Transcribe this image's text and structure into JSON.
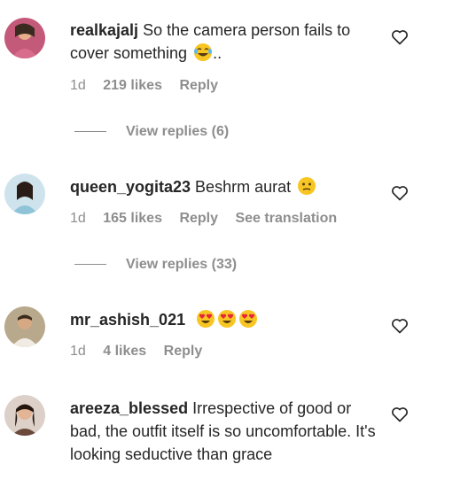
{
  "comments": [
    {
      "username": "realkajalj",
      "text": "So the camera person fails to cover something",
      "suffix": "..",
      "time": "1d",
      "likes": "219 likes",
      "reply": "Reply",
      "view_replies": "View replies (6)",
      "emoji": [
        "laughing-tears-emoji"
      ]
    },
    {
      "username": "queen_yogita23",
      "text": "Beshrm aurat",
      "time": "1d",
      "likes": "165 likes",
      "reply": "Reply",
      "see_translation": "See translation",
      "view_replies": "View replies (33)",
      "emoji": [
        "neutral-face-emoji"
      ]
    },
    {
      "username": "mr_ashish_021",
      "text": "",
      "time": "1d",
      "likes": "4 likes",
      "reply": "Reply",
      "emoji": [
        "heart-eyes-emoji",
        "heart-eyes-emoji",
        "heart-eyes-emoji"
      ]
    },
    {
      "username": "areeza_blessed",
      "text": "Irrespective of good or bad, the outfit itself is so uncomfortable. It's looking seductive than grace"
    }
  ],
  "colors": {
    "text": "#262626",
    "secondary": "#8e8e8e",
    "emoji_face": "#f7c623"
  }
}
